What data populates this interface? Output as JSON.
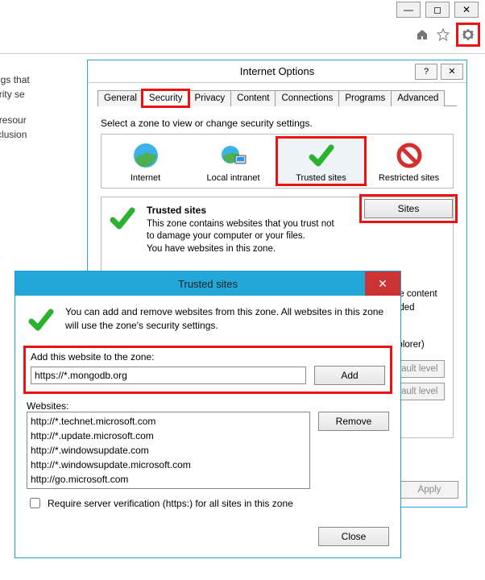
{
  "browser": {
    "partial1a": "curity settings that",
    "partial1b": "of the security se",
    "partial2a": "to network resour",
    "partial2b": "te to the inclusion"
  },
  "internetOptions": {
    "title": "Internet Options",
    "help": "?",
    "tabs": [
      "General",
      "Security",
      "Privacy",
      "Content",
      "Connections",
      "Programs",
      "Advanced"
    ],
    "zoneInstr": "Select a zone to view or change security settings.",
    "zones": [
      "Internet",
      "Local intranet",
      "Trusted sites",
      "Restricted sites"
    ],
    "desc": {
      "title": "Trusted sites",
      "line1": "This zone contains websites that you trust not to damage your computer or your files.",
      "line2": "You have websites in this zone."
    },
    "sitesBtn": "Sites",
    "level": {
      "l1": "safe content",
      "l2": "loaded",
      "l3": "Explorer)",
      "b1": "efault level",
      "b2": "efault level"
    },
    "apply": "Apply"
  },
  "trustedSites": {
    "title": "Trusted sites",
    "intro": "You can add and remove websites from this zone. All websites in this zone will use the zone's security settings.",
    "addLabel": "Add this website to the zone:",
    "addValue": "https://*.mongodb.org",
    "addBtn": "Add",
    "websitesLabel": "Websites:",
    "websites": [
      "http://*.technet.microsoft.com",
      "http://*.update.microsoft.com",
      "http://*.windowsupdate.com",
      "http://*.windowsupdate.microsoft.com",
      "http://go.microsoft.com"
    ],
    "removeBtn": "Remove",
    "requireHttps": "Require server verification (https:) for all sites in this zone",
    "closeBtn": "Close"
  }
}
